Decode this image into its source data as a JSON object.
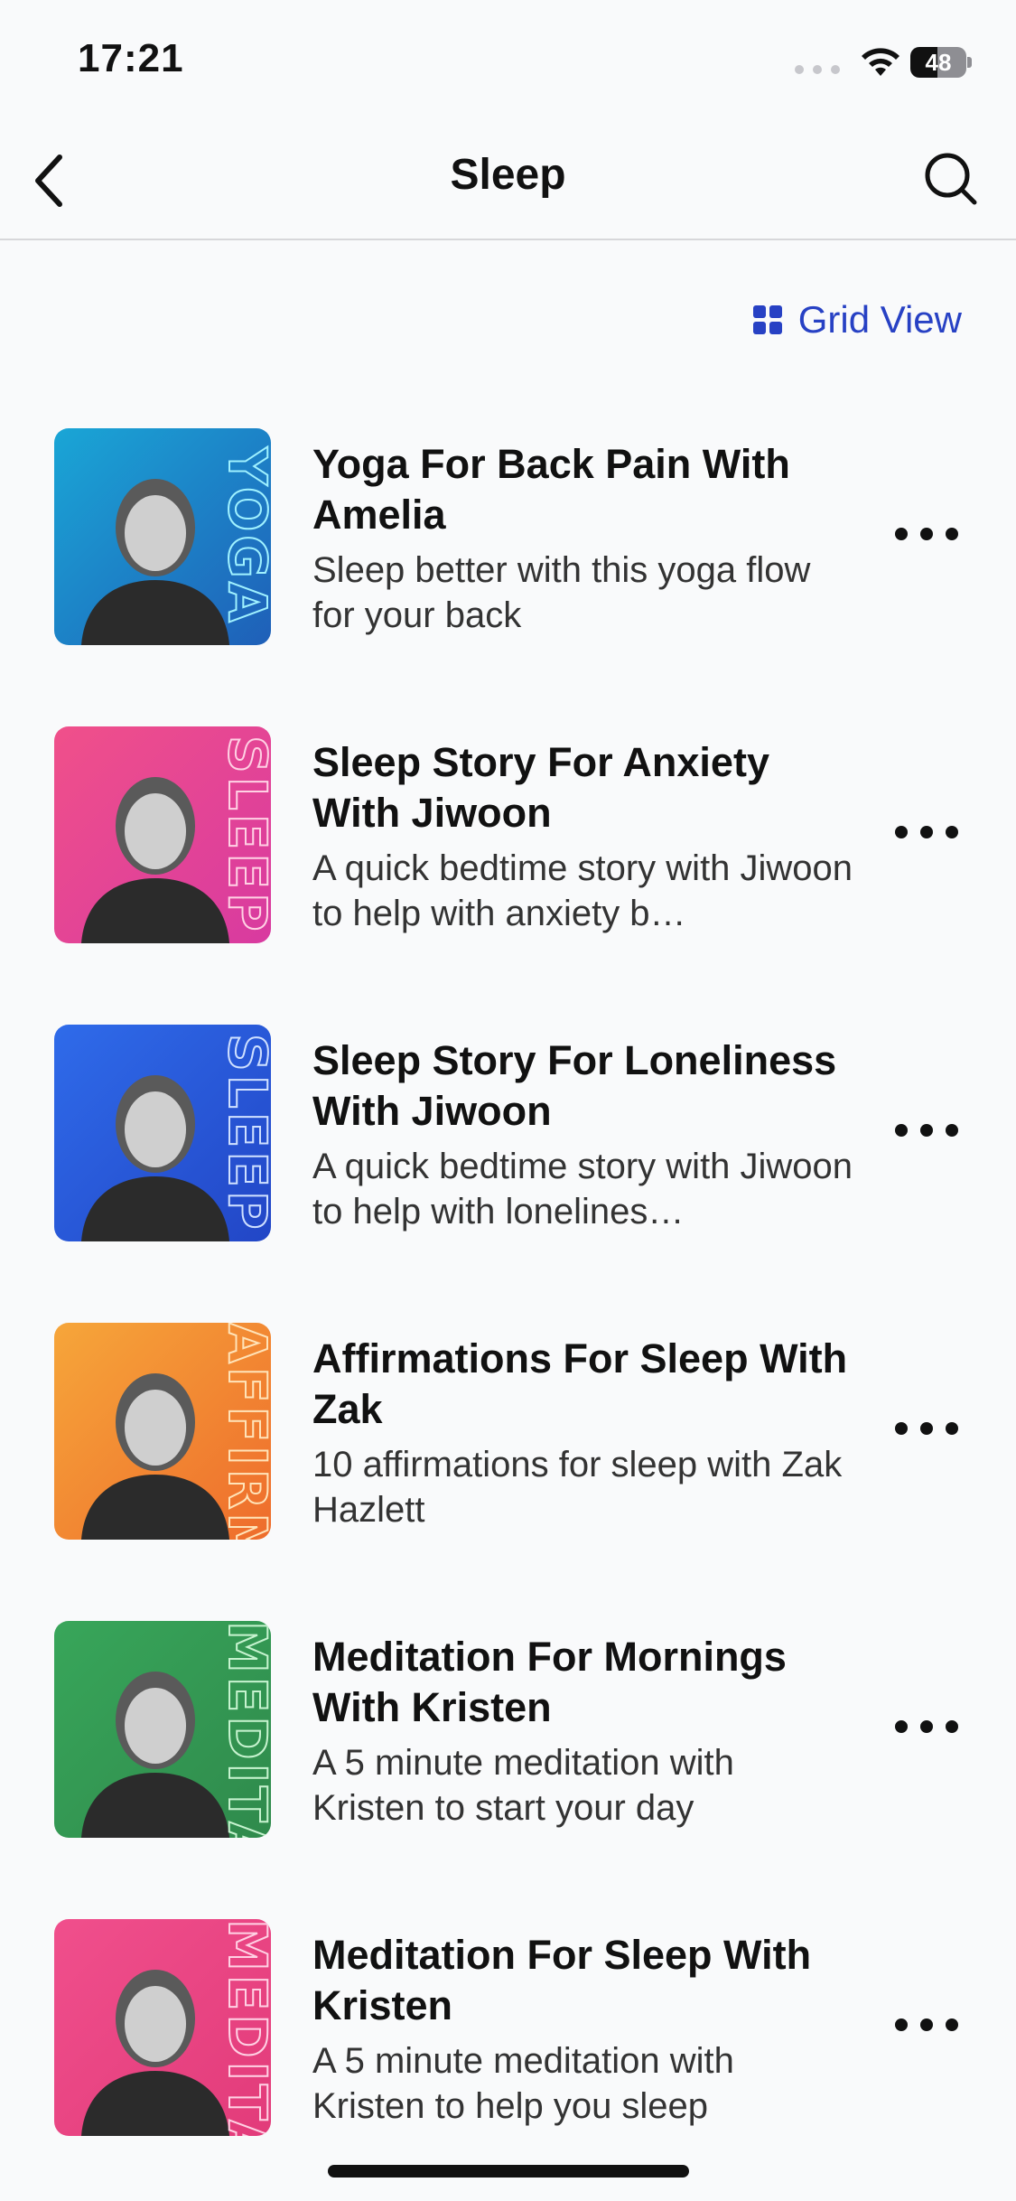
{
  "status_bar": {
    "time": "17:21",
    "battery": "48",
    "battery_level": 0.48
  },
  "nav": {
    "title": "Sleep"
  },
  "grid_view": {
    "label": "Grid View"
  },
  "items": [
    {
      "title": "Yoga For Back Pain With Amelia",
      "description": "Sleep better with this yoga flow for your back",
      "tag": "YOGA",
      "bg_from": "#1aa6d6",
      "bg_to": "#1f5fb8",
      "tag_color": "#9ff1ff"
    },
    {
      "title": "Sleep Story For Anxiety With Jiwoon",
      "description": "A quick bedtime story with Jiwoon to help with anxiety b…",
      "tag": "SLEEP",
      "bg_from": "#f0508a",
      "bg_to": "#d83aa0",
      "tag_color": "#ffd1e4"
    },
    {
      "title": "Sleep Story For Loneliness With Jiwoon",
      "description": "A quick bedtime story with Jiwoon to help with lonelines…",
      "tag": "SLEEP",
      "bg_from": "#2f6bea",
      "bg_to": "#2246c6",
      "tag_color": "#cfe0ff"
    },
    {
      "title": "Affirmations For Sleep With Zak",
      "description": "10 affirmations for sleep with Zak Hazlett",
      "tag": "AFFIRM",
      "bg_from": "#f6a63a",
      "bg_to": "#ee6c2c",
      "tag_color": "#ffe3b8"
    },
    {
      "title": "Meditation For Mornings With Kristen",
      "description": "A 5 minute meditation with Kristen to start your day",
      "tag": "MEDITATE",
      "bg_from": "#38a65a",
      "bg_to": "#2f8a4c",
      "tag_color": "#c6f3cf"
    },
    {
      "title": "Meditation For Sleep With Kristen",
      "description": "A 5 minute meditation with Kristen to help you sleep",
      "tag": "MEDITATE",
      "bg_from": "#f04f8c",
      "bg_to": "#e23b7a",
      "tag_color": "#ffd1e4"
    }
  ]
}
